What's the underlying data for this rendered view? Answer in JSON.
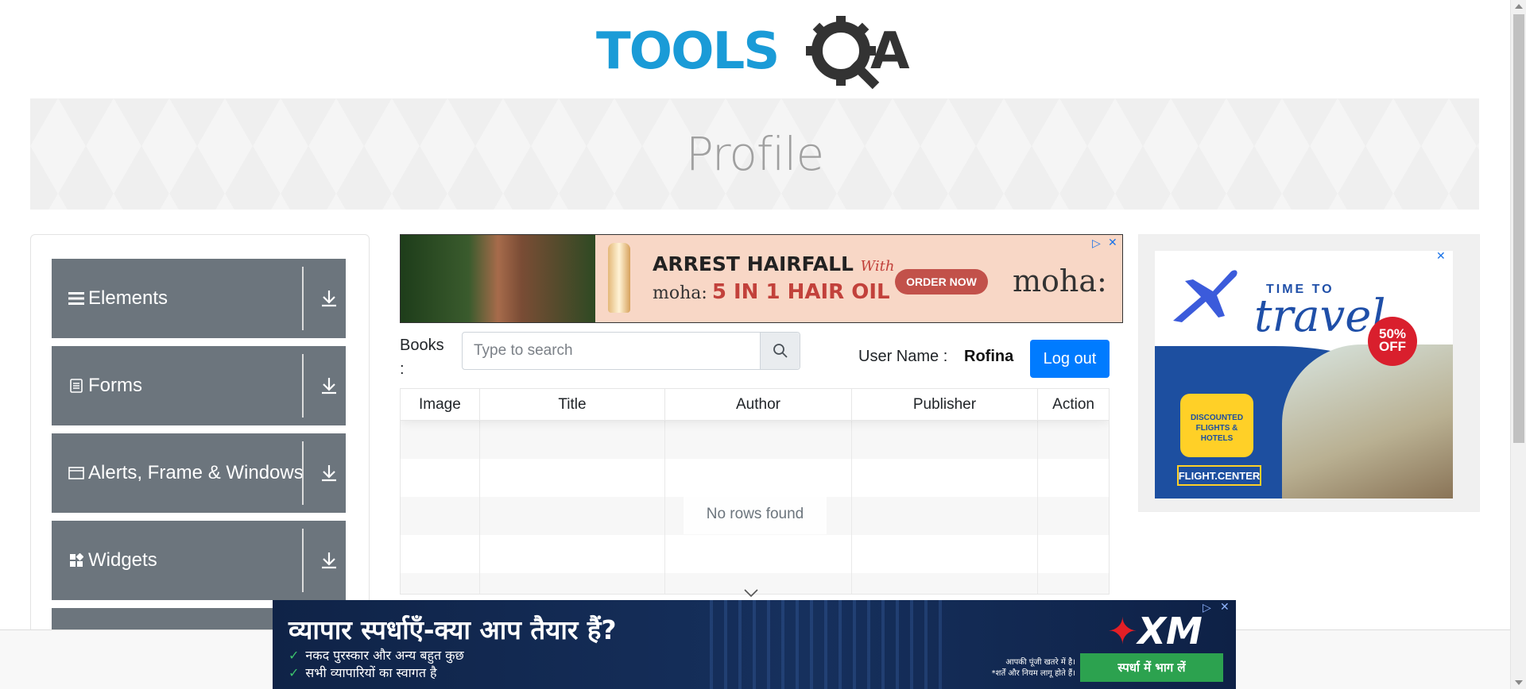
{
  "header": {
    "logo_text": "TOOLSQA"
  },
  "banner": {
    "title": "Profile"
  },
  "sidebar": {
    "groups": [
      {
        "label": "Elements",
        "icon": "hamburger-icon"
      },
      {
        "label": "Forms",
        "icon": "document-icon"
      },
      {
        "label": "Alerts, Frame & Windows",
        "icon": "window-icon"
      },
      {
        "label": "Widgets",
        "icon": "widgets-icon"
      }
    ]
  },
  "ad_top": {
    "headline": "ARREST HAIRFALL",
    "headline_suffix": "With",
    "line2_brand": "moha:",
    "line2_text": "5 IN 1 HAIR OIL",
    "cta": "ORDER NOW",
    "brand": "moha:"
  },
  "books": {
    "label": "Books :",
    "search_placeholder": "Type to search"
  },
  "user": {
    "label": "User Name :",
    "value": "Rofina",
    "logout": "Log out"
  },
  "table": {
    "columns": [
      "Image",
      "Title",
      "Author",
      "Publisher",
      "Action"
    ],
    "empty_text": "No rows found"
  },
  "ad_right": {
    "time": "TIME TO",
    "travel": "travel",
    "badge_line1": "50%",
    "badge_line2": "OFF",
    "bubble": "DISCOUNTED FLIGHTS & HOTELS",
    "brand": "FLIGHT.CENTER"
  },
  "ad_bottom": {
    "headline": "व्यापार स्पर्धाएँ-क्या आप तैयार हैं?",
    "line1": "नकद पुरस्कार और अन्य बहुत कुछ",
    "line2": "सभी व्यापारियों का स्वागत है",
    "brand": "XM",
    "risk1": "आपकी पूंजी खतरे में है।",
    "risk2": "*शर्तें और नियम लागू होते हैं।",
    "cta": "स्पर्धा में भाग लें"
  },
  "colors": {
    "sidebar_group": "#6c757d",
    "primary_button": "#007bff"
  }
}
